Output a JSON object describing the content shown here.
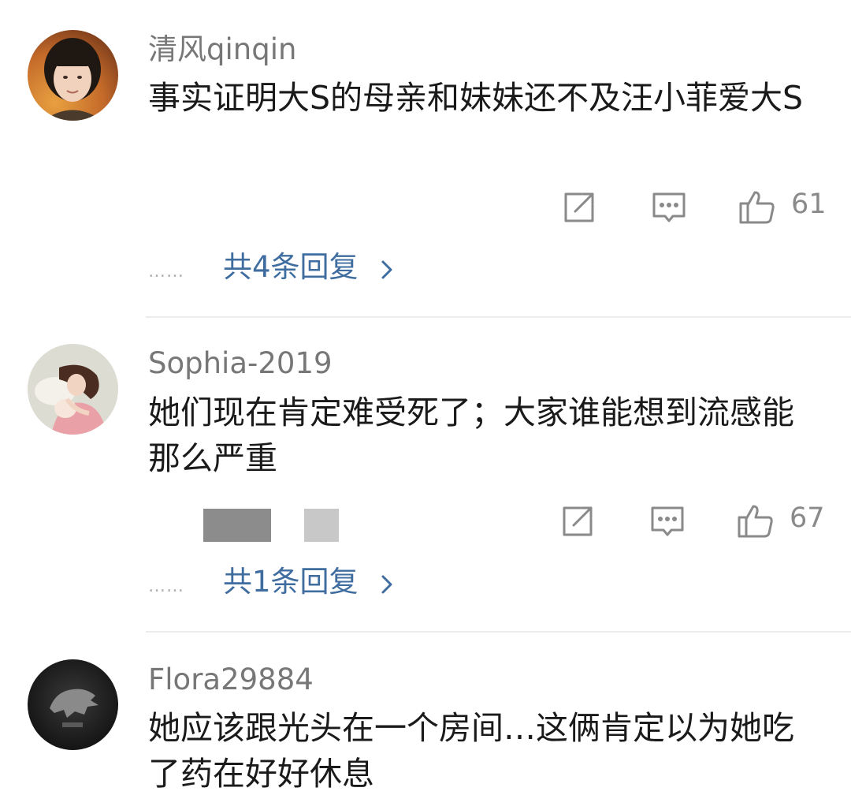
{
  "comments": [
    {
      "username": "清风qinqin",
      "text": "事实证明大S的母亲和妹妹还不及汪小菲爱大S",
      "likes": "61",
      "replies_label": "共4条回复",
      "dots": "……"
    },
    {
      "username": "Sophia-2019",
      "text": "她们现在肯定难受死了；大家谁能想到流感能那么严重",
      "likes": "67",
      "replies_label": "共1条回复",
      "dots": "……"
    },
    {
      "username": "Flora29884",
      "text": "她应该跟光头在一个房间…这俩肯定以为她吃了药在好好休息"
    }
  ],
  "icons": {
    "share": "share-icon",
    "comment": "comment-icon",
    "like": "thumbs-up-icon",
    "chevron": "chevron-right-icon"
  },
  "colors": {
    "username": "#777777",
    "text": "#1a1a1a",
    "link": "#3f6da0",
    "icon": "#8a8a8a",
    "divider": "#ececec"
  }
}
